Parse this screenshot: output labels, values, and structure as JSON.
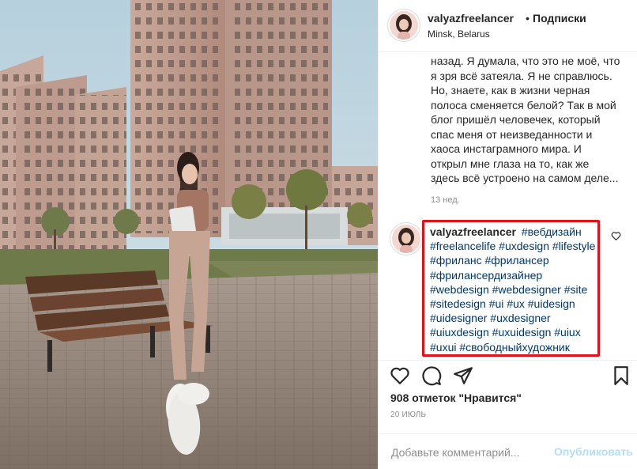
{
  "post": {
    "username": "valyazfreelancer",
    "separator": "•",
    "follow_label": "Подписки",
    "location": "Minsk, Belarus"
  },
  "caption": {
    "text": "назад. Я думала, что это не моё, что я зря всё затеяла. Я не справлюсь. Но, знаете, как в жизни черная полоса сменяется белой? Так в мой блог пришёл человечек, который спас меня от неизведанности и хаоса инстаграмного мира. И открыл мне глаза на то, как же здесь всё устроено на самом деле...",
    "time": "13 нед."
  },
  "comment": {
    "username": "valyazfreelancer",
    "hashtags": [
      "#вебдизайн",
      "#freelancelife",
      "#uxdesign",
      "#lifestyle",
      "#фриланс",
      "#фрилансер",
      "#фрилансердизайнер",
      "#webdesign",
      "#webdesigner",
      "#site",
      "#sitedesign",
      "#ui",
      "#ux",
      "#uidesign",
      "#uidesigner",
      "#uxdesigner",
      "#uiuxdesign",
      "#uxuidesign",
      "#uiux",
      "#uxui",
      "#свободныйхудожник"
    ]
  },
  "stats": {
    "likes": "908 отметок \"Нравится\"",
    "date": "20 ИЮЛЬ"
  },
  "comment_input": {
    "placeholder": "Добавьте комментарий...",
    "publish_label": "Опубликовать"
  },
  "colors": {
    "hashtag": "#00376b",
    "highlight_border": "#e2101a",
    "publish_disabled": "#b2dffc",
    "secondary_text": "#8e8e8e"
  },
  "icons": {
    "like": "heart-outline-icon",
    "comment": "speech-bubble-icon",
    "share": "paper-plane-icon",
    "save": "bookmark-icon"
  }
}
